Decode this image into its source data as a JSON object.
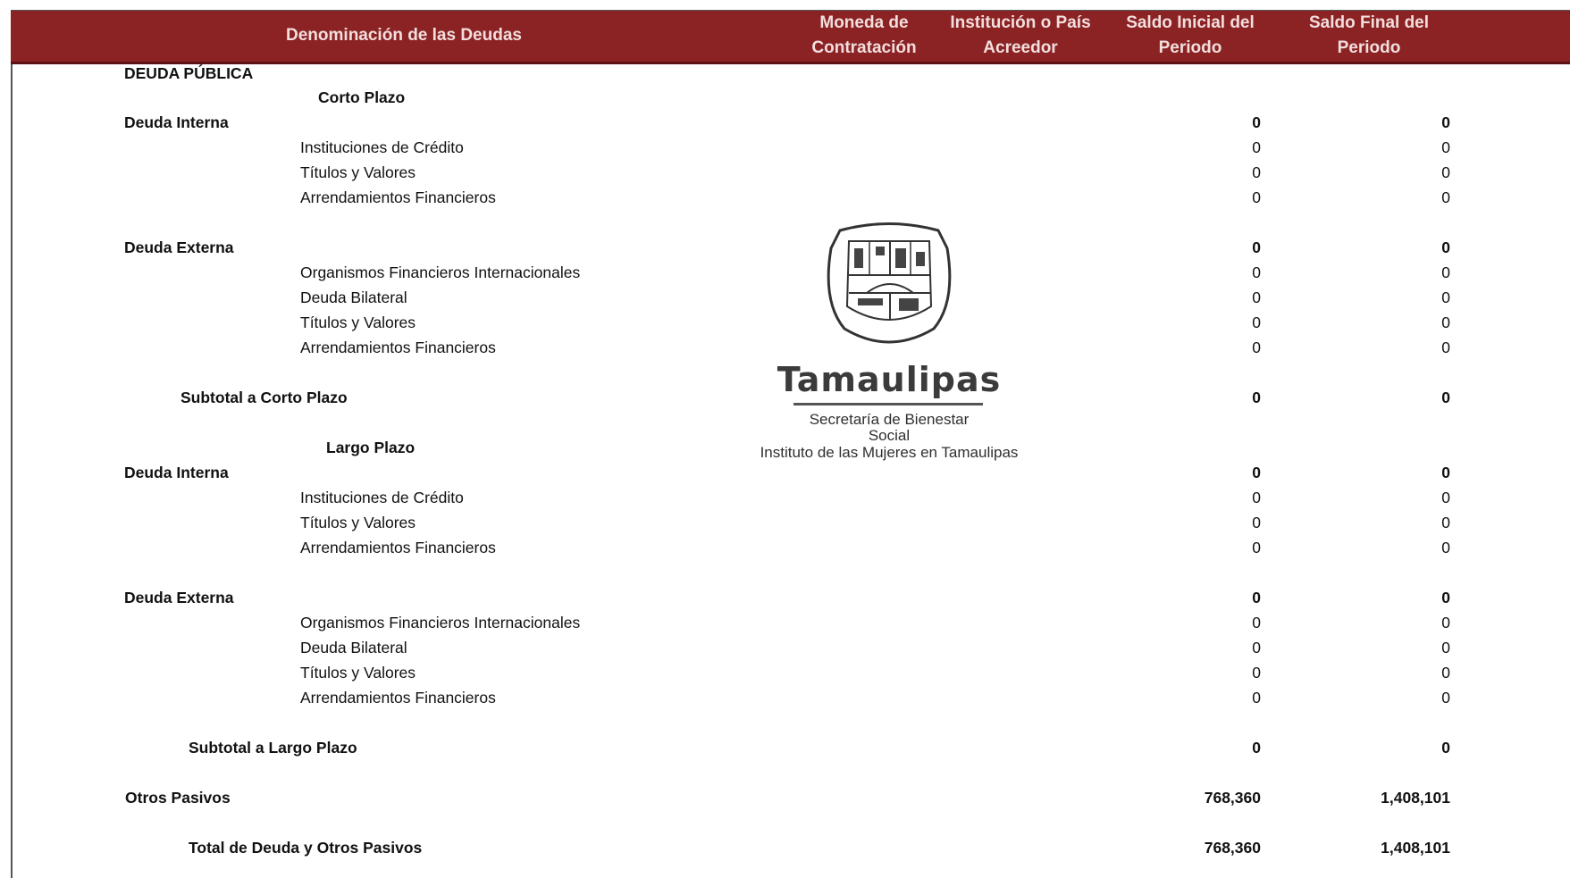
{
  "header": {
    "col_denominacion": "Denominación de las Deudas",
    "col_moneda": "Moneda de\nContratación",
    "col_institucion": "Institución o País\nAcreedor",
    "col_saldo_inicial": "Saldo Inicial del\nPeriodo",
    "col_saldo_final": "Saldo Final del\nPeriodo"
  },
  "rows": [
    {
      "label": "DEUDA PÚBLICA",
      "inicial": "",
      "final": ""
    },
    {
      "label": "Corto Plazo",
      "inicial": "",
      "final": ""
    },
    {
      "label": "Deuda Interna",
      "inicial": "0",
      "final": "0"
    },
    {
      "label": "Instituciones de Crédito",
      "inicial": "0",
      "final": "0"
    },
    {
      "label": "Títulos y Valores",
      "inicial": "0",
      "final": "0"
    },
    {
      "label": "Arrendamientos Financieros",
      "inicial": "0",
      "final": "0"
    },
    {
      "label": "Deuda Externa",
      "inicial": "0",
      "final": "0"
    },
    {
      "label": "Organismos Financieros Internacionales",
      "inicial": "0",
      "final": "0"
    },
    {
      "label": "Deuda Bilateral",
      "inicial": "0",
      "final": "0"
    },
    {
      "label": "Títulos y Valores",
      "inicial": "0",
      "final": "0"
    },
    {
      "label": "Arrendamientos Financieros",
      "inicial": "0",
      "final": "0"
    },
    {
      "label": "Subtotal a Corto Plazo",
      "inicial": "0",
      "final": "0"
    },
    {
      "label": "Largo Plazo",
      "inicial": "",
      "final": ""
    },
    {
      "label": "Deuda Interna",
      "inicial": "0",
      "final": "0"
    },
    {
      "label": "Instituciones de Crédito",
      "inicial": "0",
      "final": "0"
    },
    {
      "label": "Títulos y Valores",
      "inicial": "0",
      "final": "0"
    },
    {
      "label": "Arrendamientos Financieros",
      "inicial": "0",
      "final": "0"
    },
    {
      "label": "Deuda Externa",
      "inicial": "0",
      "final": "0"
    },
    {
      "label": "Organismos Financieros Internacionales",
      "inicial": "0",
      "final": "0"
    },
    {
      "label": "Deuda Bilateral",
      "inicial": "0",
      "final": "0"
    },
    {
      "label": "Títulos y Valores",
      "inicial": "0",
      "final": "0"
    },
    {
      "label": "Arrendamientos Financieros",
      "inicial": "0",
      "final": "0"
    },
    {
      "label": "Subtotal a Largo Plazo",
      "inicial": "0",
      "final": "0"
    },
    {
      "label": "Otros Pasivos",
      "inicial": "768,360",
      "final": "1,408,101"
    },
    {
      "label": "Total de Deuda y Otros Pasivos",
      "inicial": "768,360",
      "final": "1,408,101"
    }
  ],
  "stamp": {
    "title": "Tamaulipas",
    "line1": "Secretaría de Bienestar",
    "line2": "Social",
    "line3": "Instituto de las Mujeres en Tamaulipas"
  }
}
